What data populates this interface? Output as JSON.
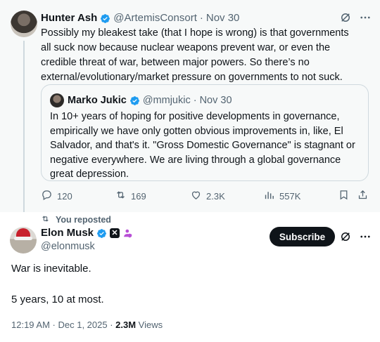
{
  "retweeted_tweet": {
    "author_name": "Hunter Ash",
    "handle": "@ArtemisConsort",
    "dot": "·",
    "date": "Nov 30",
    "text": "Possibly my bleakest take (that I hope is wrong) is that governments all suck now because nuclear weapons prevent war, or even the credible threat of war, between major powers. So there’s no external/evolutionary/market pressure on governments to not suck.",
    "quote": {
      "author_name": "Marko Jukic",
      "handle": "@mmjukic",
      "dot": "·",
      "date": "Nov 30",
      "text": "In 10+ years of hoping for positive developments in governance, empirically we have only gotten obvious improvements in, like, El Salvador, and that's it. \"Gross Domestic Governance\" is stagnant or negative everywhere. We are living through a global governance great depression."
    },
    "actions": {
      "replies": "120",
      "reposts": "169",
      "likes": "2.3K",
      "views": "557K"
    }
  },
  "reposted_label": "You reposted",
  "main_tweet": {
    "author_name": "Elon Musk",
    "handle": "@elonmusk",
    "subscribe_label": "Subscribe",
    "line1": "War is inevitable.",
    "line2": "5 years, 10 at most.",
    "timestamp": "12:19 AM · Dec 1, 2025 · ",
    "views_count": "2.3M",
    "views_label": " Views"
  },
  "colors": {
    "verified": "#1d9bf0",
    "text": "#0f1419",
    "muted": "#536471",
    "highlight_band": "#f7f9f9",
    "affiliate_badge": "#b84fd6"
  },
  "icons": [
    "grok-icon",
    "more-icon",
    "reply-icon",
    "repost-icon",
    "like-icon",
    "views-icon",
    "bookmark-icon",
    "share-icon",
    "verified-icon",
    "x-affiliate-icon",
    "person-badge-icon"
  ]
}
